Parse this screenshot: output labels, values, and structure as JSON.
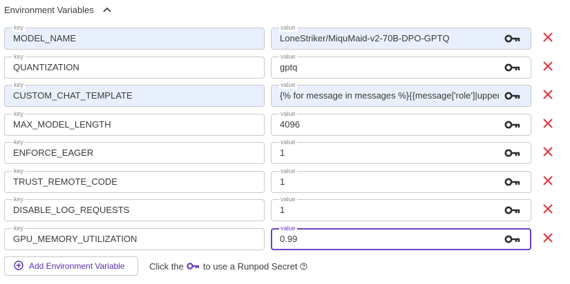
{
  "section": {
    "title": "Environment Variables"
  },
  "field_labels": {
    "key": "key",
    "value": "value"
  },
  "env_vars": [
    {
      "key": "MODEL_NAME",
      "value": "LoneStriker/MiquMaid-v2-70B-DPO-GPTQ"
    },
    {
      "key": "QUANTIZATION",
      "value": "gptq"
    },
    {
      "key": "CUSTOM_CHAT_TEMPLATE",
      "value": "{% for message in messages %}{{message['role']|upper"
    },
    {
      "key": "MAX_MODEL_LENGTH",
      "value": "4096"
    },
    {
      "key": "ENFORCE_EAGER",
      "value": "1"
    },
    {
      "key": "TRUST_REMOTE_CODE",
      "value": "1"
    },
    {
      "key": "DISABLE_LOG_REQUESTS",
      "value": "1"
    },
    {
      "key": "GPU_MEMORY_UTILIZATION",
      "value": "0.99"
    }
  ],
  "footer": {
    "add_label": "Add Environment Variable",
    "hint_before": "Click the",
    "hint_after": "to use a Runpod Secret"
  },
  "colors": {
    "accent": "#6d3fc6",
    "delete": "#e0333a",
    "filled_bg": "#e9f0fd"
  },
  "icons": {
    "toggle": "chevron-up-icon",
    "secret": "key-icon",
    "remove": "close-icon",
    "add": "plus-circle-icon",
    "help": "help-circle-icon"
  }
}
